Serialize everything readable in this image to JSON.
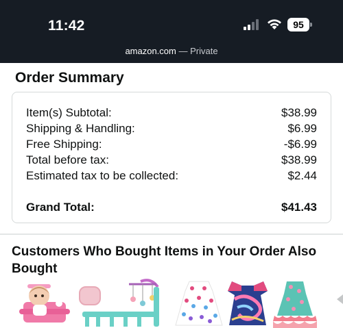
{
  "status_bar": {
    "time": "11:42",
    "battery": "95",
    "url_host": "amazon.com",
    "url_suffix": " — Private"
  },
  "order_summary": {
    "title": "Order Summary",
    "rows": [
      {
        "label": "Item(s) Subtotal:",
        "value": "$38.99"
      },
      {
        "label": "Shipping & Handling:",
        "value": "$6.99"
      },
      {
        "label": "Free Shipping:",
        "value": "-$6.99"
      },
      {
        "label": "Total before tax:",
        "value": "$38.99"
      },
      {
        "label": "Estimated tax to be collected:",
        "value": "$2.44"
      },
      {
        "label": "Grand Total:",
        "value": "$41.43"
      }
    ]
  },
  "recommendations": {
    "title": "Customers Who Bought Items in Your Order Also Bought",
    "products": [
      {
        "icon": "baby-doll-highchair-icon"
      },
      {
        "icon": "doll-crib-mobile-icon"
      },
      {
        "icon": "doll-dress-hearts-icon"
      },
      {
        "icon": "doll-dress-swirl-icon"
      },
      {
        "icon": "doll-dress-floral-icon"
      }
    ]
  },
  "colors": {
    "status_bar_bg": "#161c24",
    "text": "#0f1111",
    "border": "#d5d9d9"
  }
}
